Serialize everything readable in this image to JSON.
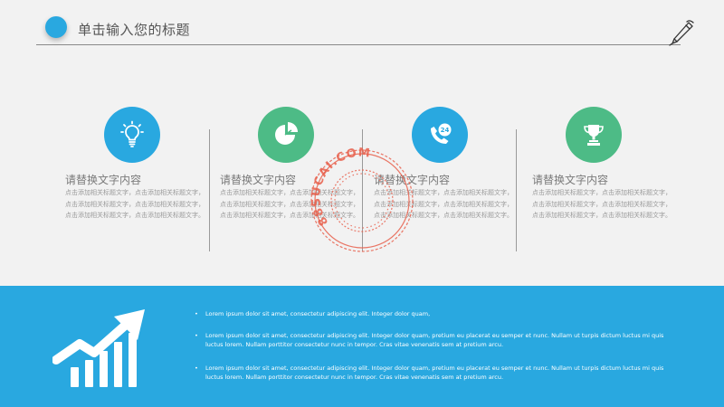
{
  "header": {
    "title": "单击输入您的标题",
    "accent_color": "#29a8e0",
    "pen_icon": "pen-icon"
  },
  "cards": [
    {
      "icon": "lightbulb-icon",
      "color": "#29a8e0",
      "title": "请替换文字内容",
      "body": "点击添加相关标题文字，点击添加相关标题文字，点击添加相关标题文字，点击添加相关标题文字，点击添加相关标题文字，点击添加相关标题文字。"
    },
    {
      "icon": "pie-chart-icon",
      "color": "#4dbb86",
      "title": "请替换文字内容",
      "body": "点击添加相关标题文字，点击添加相关标题文字，点击添加相关标题文字，点击添加相关标题文字，点击添加相关标题文字，点击添加相关标题文字。"
    },
    {
      "icon": "phone-24h-icon",
      "color": "#29a8e0",
      "title": "请替换文字内容",
      "body": "点击添加相关标题文字，点击添加相关标题文字，点击添加相关标题文字，点击添加相关标题文字，点击添加相关标题文字，点击添加相关标题文字。"
    },
    {
      "icon": "trophy-icon",
      "color": "#4dbb86",
      "title": "请替换文字内容",
      "body": "点击添加相关标题文字，点击添加相关标题文字，点击添加相关标题文字，点击添加相关标题文字，点击添加相关标题文字，点击添加相关标题文字。"
    }
  ],
  "watermark": {
    "text": "88SUCAI.COM",
    "color": "#e8604c"
  },
  "band": {
    "color": "#29a8e0",
    "icon": "growth-chart-icon",
    "bullet_char": "•",
    "bullets": [
      "Lorem ipsum dolor sit amet, consectetur adipiscing elit. Integer dolor quam,",
      "Lorem ipsum dolor sit amet, consectetur adipiscing elit. Integer dolor quam, pretium eu placerat eu semper et nunc. Nullam ut turpis dictum luctus mi quis luctus lorem. Nullam porttitor consectetur nunc in tempor. Cras vitae venenatis sem at pretium arcu.",
      "Lorem ipsum dolor sit amet, consectetur adipiscing elit. Integer dolor quam, pretium eu placerat eu semper et nunc. Nullam ut turpis dictum luctus mi quis luctus lorem. Nullam porttitor consectetur nunc in tempor. Cras vitae venenatis sem at pretium arcu."
    ]
  }
}
